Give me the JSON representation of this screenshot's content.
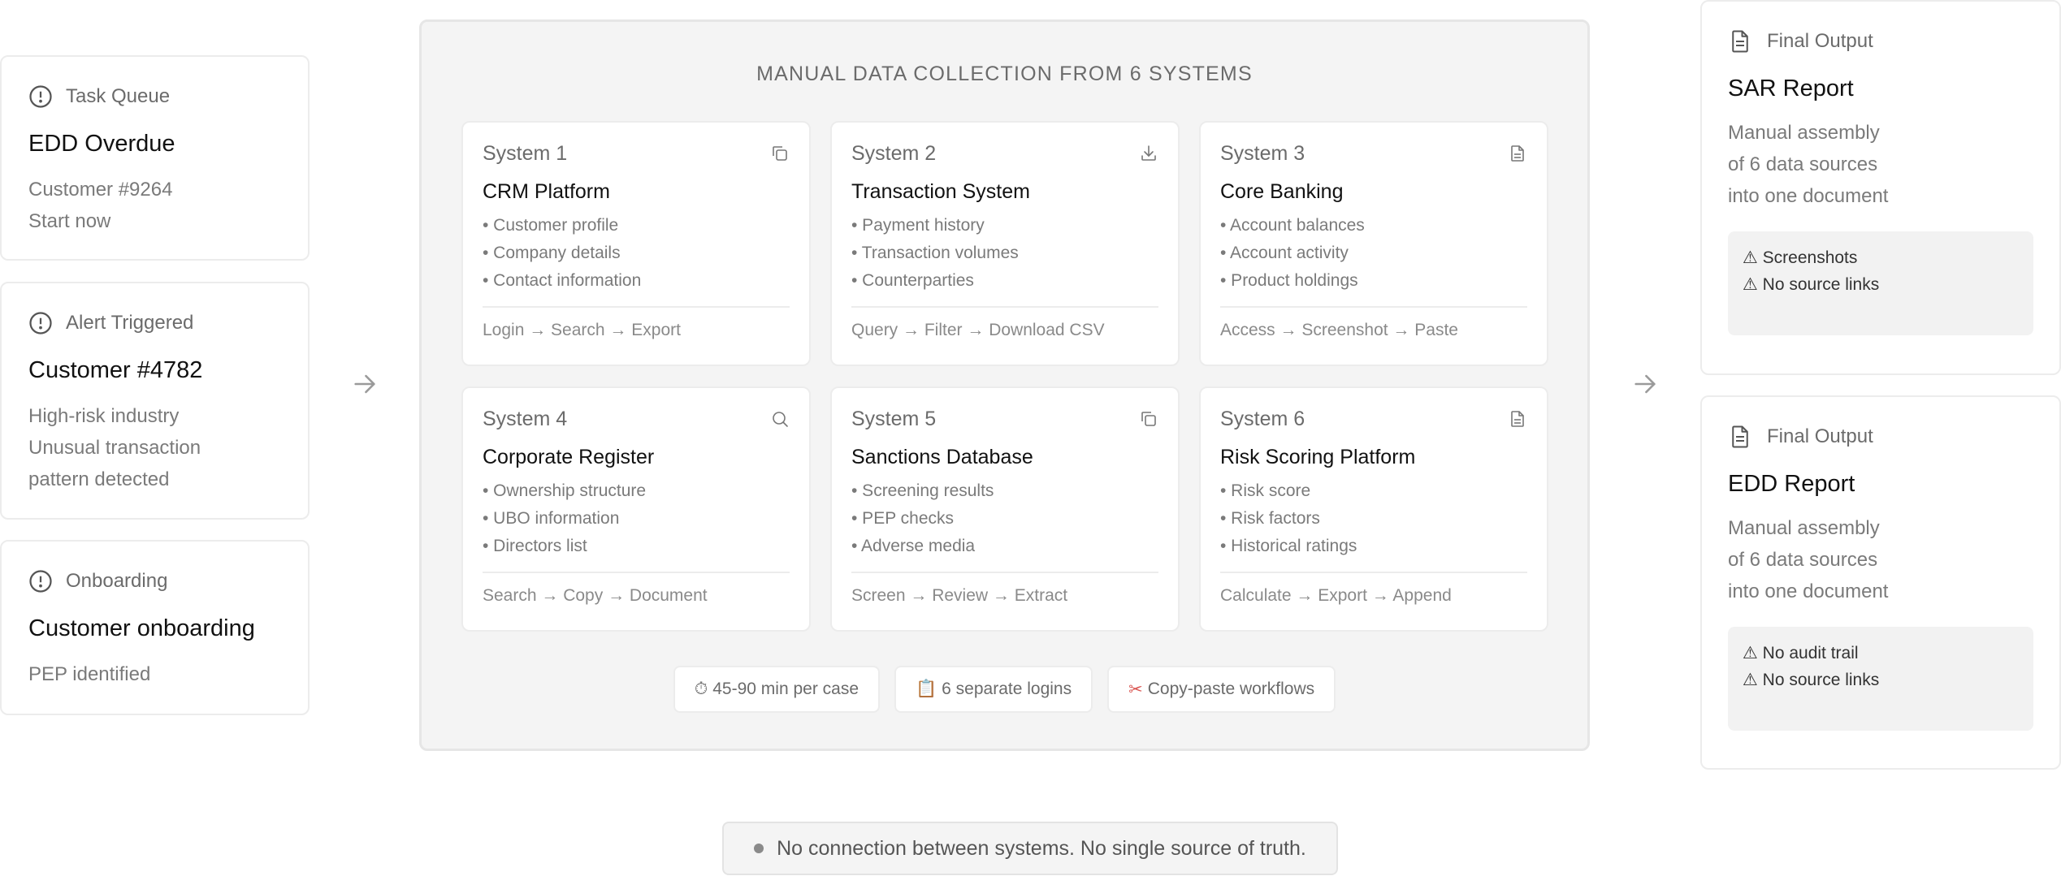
{
  "queue": [
    {
      "kicker": "Task Queue",
      "title": "EDD Overdue",
      "lines": [
        "Customer #9264",
        "Start now"
      ],
      "icon": "alert-circle-icon"
    },
    {
      "kicker": "Alert Triggered",
      "title": "Customer #4782",
      "lines": [
        "High-risk industry",
        "Unusual transaction",
        "pattern detected"
      ],
      "icon": "alert-circle-icon"
    },
    {
      "kicker": "Onboarding",
      "title": "Customer onboarding",
      "lines": [
        "PEP identified"
      ],
      "icon": "alert-circle-icon"
    }
  ],
  "panel": {
    "title": "MANUAL DATA COLLECTION FROM 6 SYSTEMS",
    "systems": [
      {
        "number": "System 1",
        "name": "CRM Platform",
        "icon": "copy-icon",
        "items": [
          "• Customer profile",
          "• Company details",
          "• Contact information"
        ],
        "steps": "Login → Search → Export"
      },
      {
        "number": "System 2",
        "name": "Transaction System",
        "icon": "download-icon",
        "items": [
          "• Payment history",
          "• Transaction volumes",
          "• Counterparties"
        ],
        "steps": "Query → Filter → Download CSV"
      },
      {
        "number": "System 3",
        "name": "Core Banking",
        "icon": "file-text-icon",
        "items": [
          "• Account balances",
          "• Account activity",
          "• Product holdings"
        ],
        "steps": "Access → Screenshot → Paste"
      },
      {
        "number": "System 4",
        "name": "Corporate Register",
        "icon": "search-icon",
        "items": [
          "• Ownership structure",
          "• UBO information",
          "• Directors list"
        ],
        "steps": "Search → Copy → Document"
      },
      {
        "number": "System 5",
        "name": "Sanctions Database",
        "icon": "copy-icon",
        "items": [
          "• Screening results",
          "• PEP checks",
          "• Adverse media"
        ],
        "steps": "Screen → Review → Extract"
      },
      {
        "number": "System 6",
        "name": "Risk Scoring Platform",
        "icon": "file-text-icon",
        "items": [
          "• Risk score",
          "• Risk factors",
          "• Historical ratings"
        ],
        "steps": "Calculate → Export → Append"
      }
    ],
    "chips": [
      {
        "glyph": "⏱",
        "label": "45-90 min per case",
        "icon": "stopwatch-icon"
      },
      {
        "glyph": "📋",
        "label": "6 separate logins",
        "icon": "clipboard-icon"
      },
      {
        "glyph": "✂",
        "label": "Copy-paste workflows",
        "icon": "scissors-icon"
      }
    ]
  },
  "outputs": [
    {
      "kicker": "Final Output",
      "title": "SAR Report",
      "lines": [
        "Manual assembly",
        "of 6 data sources",
        "into one document"
      ],
      "warnings": [
        "⚠ Screenshots",
        "⚠ No source links"
      ],
      "icon": "document-icon"
    },
    {
      "kicker": "Final Output",
      "title": "EDD Report",
      "lines": [
        "Manual assembly",
        "of 6 data sources",
        "into one document"
      ],
      "warnings": [
        "⚠ No audit trail",
        "⚠ No source links"
      ],
      "icon": "document-icon"
    }
  ],
  "footer": {
    "text": "No connection between systems. No single source of truth."
  },
  "colors": {
    "card_border": "#ececec",
    "panel_bg": "#f4f4f4",
    "muted_text": "#7a7a7a",
    "accent_red": "#d9534f"
  }
}
